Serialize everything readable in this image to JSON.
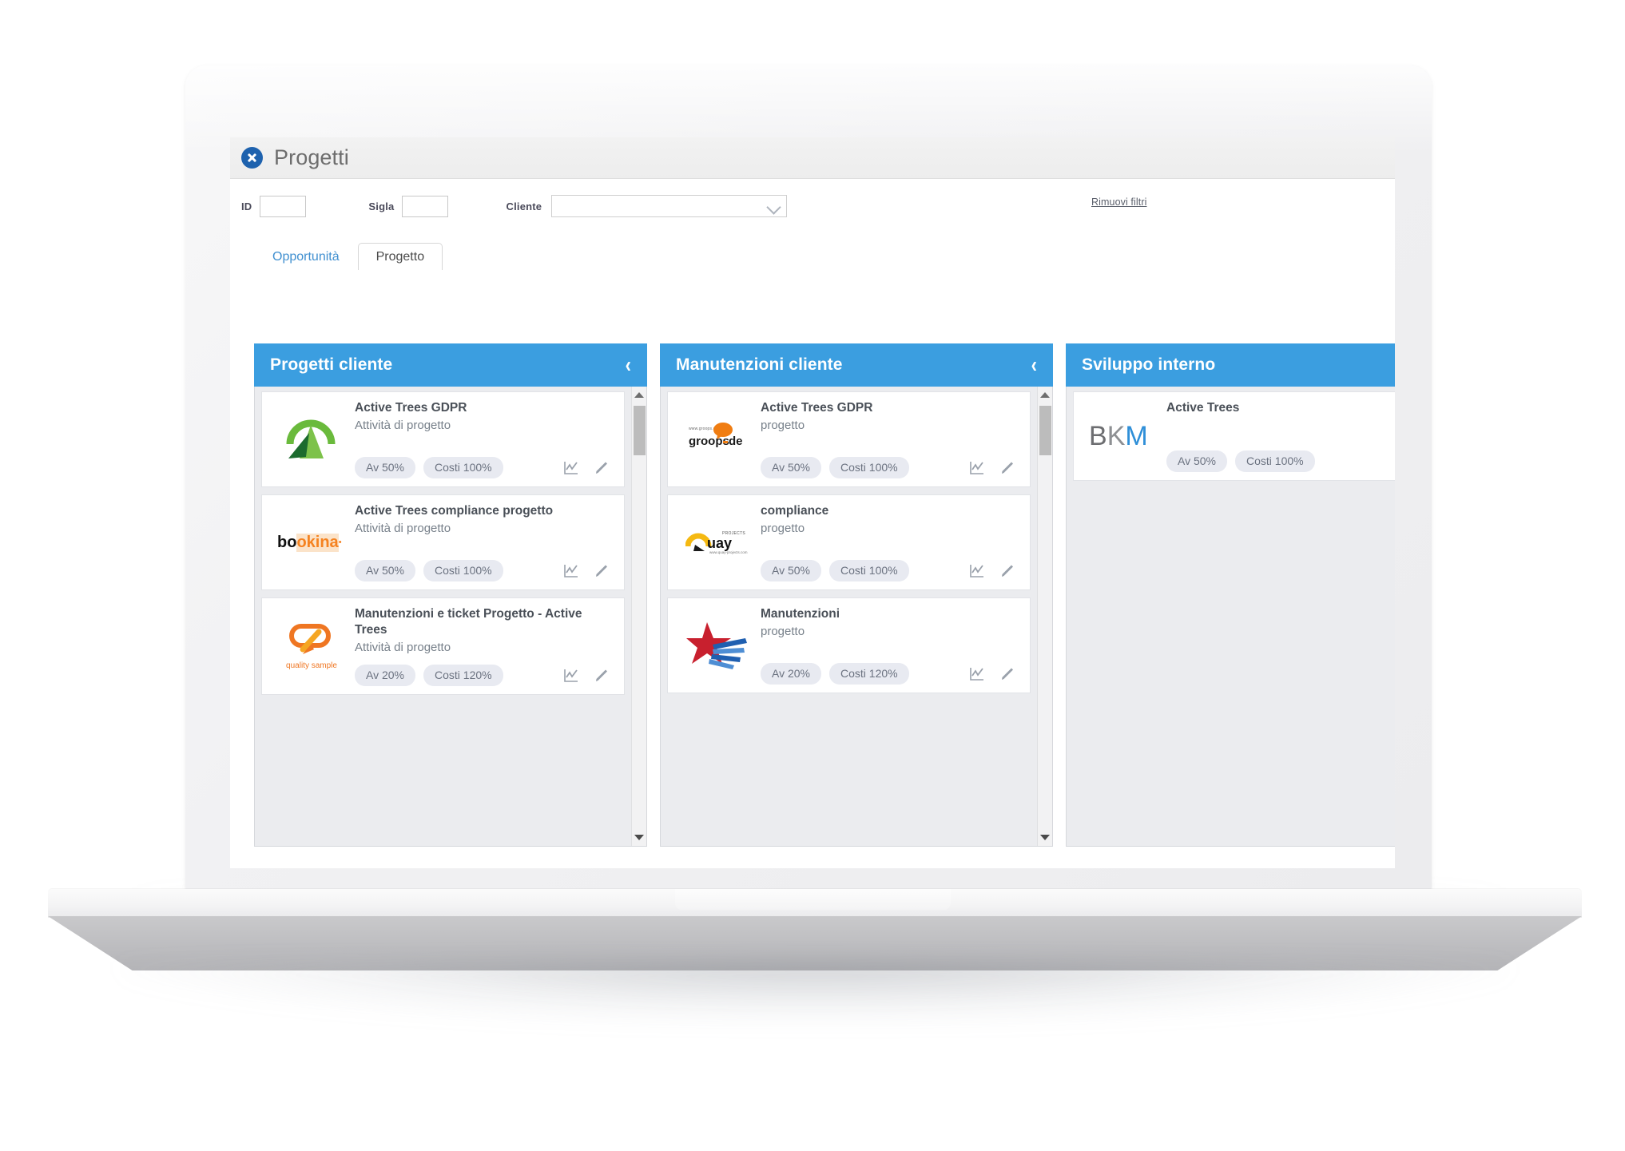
{
  "window": {
    "title": "Progetti",
    "close_icon": "close-circle-icon"
  },
  "filters": {
    "id_label": "ID",
    "id_value": "",
    "sigla_label": "Sigla",
    "sigla_value": "",
    "cliente_label": "Cliente",
    "cliente_value": "",
    "remove_filters_label": "Rimuovi filtri"
  },
  "tabs": [
    {
      "label": "Opportunità",
      "active": false
    },
    {
      "label": "Progetto",
      "active": true
    }
  ],
  "colors": {
    "column_header": "#3b9ee0",
    "tab_link": "#3f8fd0",
    "close_badge": "#1e62ae",
    "pill_bg": "#e8eaf1",
    "board_bg": "#ebecef"
  },
  "columns": [
    {
      "title": "Progetti cliente",
      "collapse_icon": "chevron-left-icon",
      "cards": [
        {
          "title": "Active Trees GDPR",
          "subtitle": "Attività di progetto",
          "logo": "active-trees-logo",
          "pills": [
            "Av 50%",
            "Costi 100%"
          ],
          "actions": [
            "chart-icon",
            "pencil-icon"
          ]
        },
        {
          "title": "Active Trees compliance progetto",
          "subtitle": "Attività di progetto",
          "logo": "bookina-logo",
          "pills": [
            "Av 50%",
            "Costi 100%"
          ],
          "actions": [
            "chart-icon",
            "pencil-icon"
          ]
        },
        {
          "title": "Manutenzioni e ticket Progetto - Active Trees",
          "subtitle": "Attività di progetto",
          "logo": "quality-sample-logo",
          "pills": [
            "Av 20%",
            "Costi 120%"
          ],
          "actions": [
            "chart-icon",
            "pencil-icon"
          ]
        }
      ],
      "scrollbar": {
        "up_icon": "triangle-up-icon",
        "down_icon": "triangle-down-icon"
      }
    },
    {
      "title": "Manutenzioni cliente",
      "collapse_icon": "chevron-left-icon",
      "cards": [
        {
          "title": "Active Trees GDPR",
          "subtitle": "progetto",
          "logo": "groops-de-logo",
          "pills": [
            "Av 50%",
            "Costi 100%"
          ],
          "actions": [
            "chart-icon",
            "pencil-icon"
          ]
        },
        {
          "title": "compliance",
          "subtitle": "progetto",
          "logo": "quay-logo",
          "pills": [
            "Av 50%",
            "Costi 100%"
          ],
          "actions": [
            "chart-icon",
            "pencil-icon"
          ]
        },
        {
          "title": "Manutenzioni",
          "subtitle": "progetto",
          "logo": "red-star-logo",
          "pills": [
            "Av 20%",
            "Costi 120%"
          ],
          "actions": [
            "chart-icon",
            "pencil-icon"
          ]
        }
      ],
      "scrollbar": {
        "up_icon": "triangle-up-icon",
        "down_icon": "triangle-down-icon"
      }
    },
    {
      "title": "Sviluppo interno",
      "collapse_icon": "",
      "cards": [
        {
          "title": "Active Trees",
          "subtitle": "",
          "logo": "bkm-logo",
          "pills": [
            "Av 50%",
            "Costi 100%"
          ],
          "actions": []
        }
      ],
      "scrollbar": null
    }
  ],
  "logos": {
    "bookina": {
      "part1": "bo",
      "part2": "okina"
    },
    "groops": {
      "small": "www.groops.de",
      "main": "groops",
      "suffix": "de"
    },
    "quality_sample": {
      "caption": "quality sample"
    },
    "quay": {
      "small": "PROJECTS",
      "main": "uay",
      "sub": "www.quay-projects.com"
    },
    "bkm": {
      "b": "B",
      "k": "K",
      "m": "M"
    }
  }
}
